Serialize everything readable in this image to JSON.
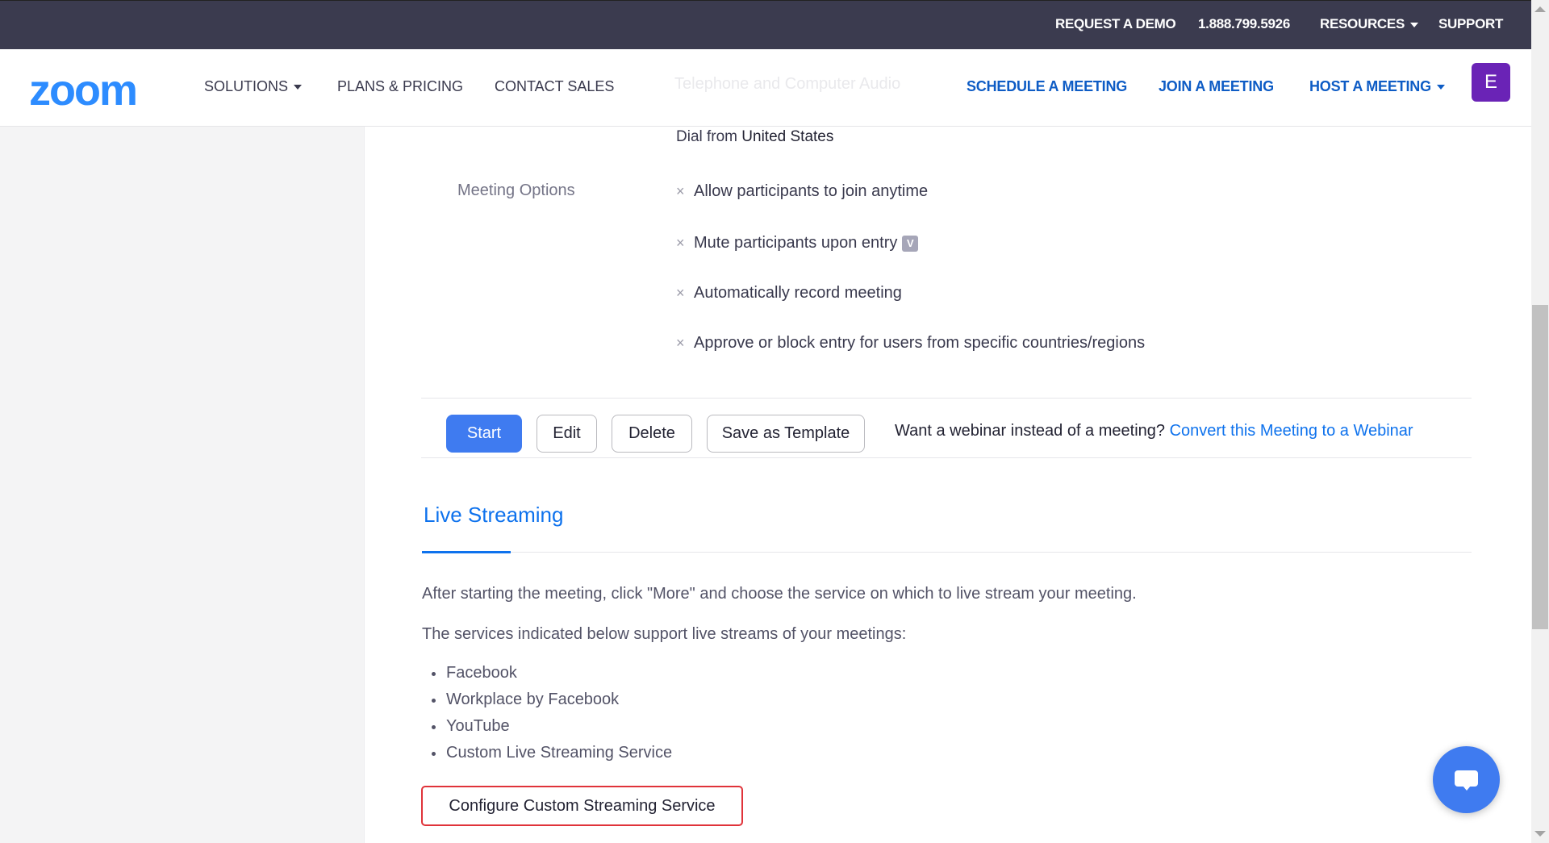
{
  "topbar": {
    "request_demo": "REQUEST A DEMO",
    "phone": "1.888.799.5926",
    "resources": "RESOURCES",
    "support": "SUPPORT"
  },
  "navbar": {
    "logo": "zoom",
    "solutions": "SOLUTIONS",
    "plans": "PLANS & PRICING",
    "contact": "CONTACT SALES",
    "ghost_text": "Telephone and Computer Audio",
    "schedule": "SCHEDULE A MEETING",
    "join": "JOIN A MEETING",
    "host": "HOST A MEETING",
    "avatar_initial": "E"
  },
  "meeting": {
    "dial_prefix": "Dial from",
    "dial_country": "United States",
    "options_label": "Meeting Options",
    "options": [
      "Allow participants to join anytime",
      "Mute participants upon entry",
      "Automatically record meeting",
      "Approve or block entry for users from specific countries/regions"
    ],
    "option_marker": "×",
    "mute_badge": "V"
  },
  "actions": {
    "start": "Start",
    "edit": "Edit",
    "delete": "Delete",
    "save_template": "Save as Template",
    "webinar_question": "Want a webinar instead of a meeting?",
    "convert_link": "Convert this Meeting to a Webinar"
  },
  "live_streaming": {
    "title": "Live Streaming",
    "intro": "After starting the meeting, click \"More\" and choose the service on which to live stream your meeting.",
    "services_intro": "The services indicated below support live streams of your meetings:",
    "services": [
      "Facebook",
      "Workplace by Facebook",
      "YouTube",
      "Custom Live Streaming Service"
    ],
    "configure_button": "Configure Custom Streaming Service"
  },
  "colors": {
    "topbar_bg": "#3b3b4f",
    "brand_blue": "#2d8cff",
    "link_blue": "#0e72ed",
    "button_blue": "#3f7bf0",
    "avatar_purple": "#6a23b6",
    "highlight_red": "#e0333a"
  },
  "icons": {
    "caret": "caret-down-icon",
    "chat": "chat-bubble-icon",
    "close": "x-icon"
  }
}
